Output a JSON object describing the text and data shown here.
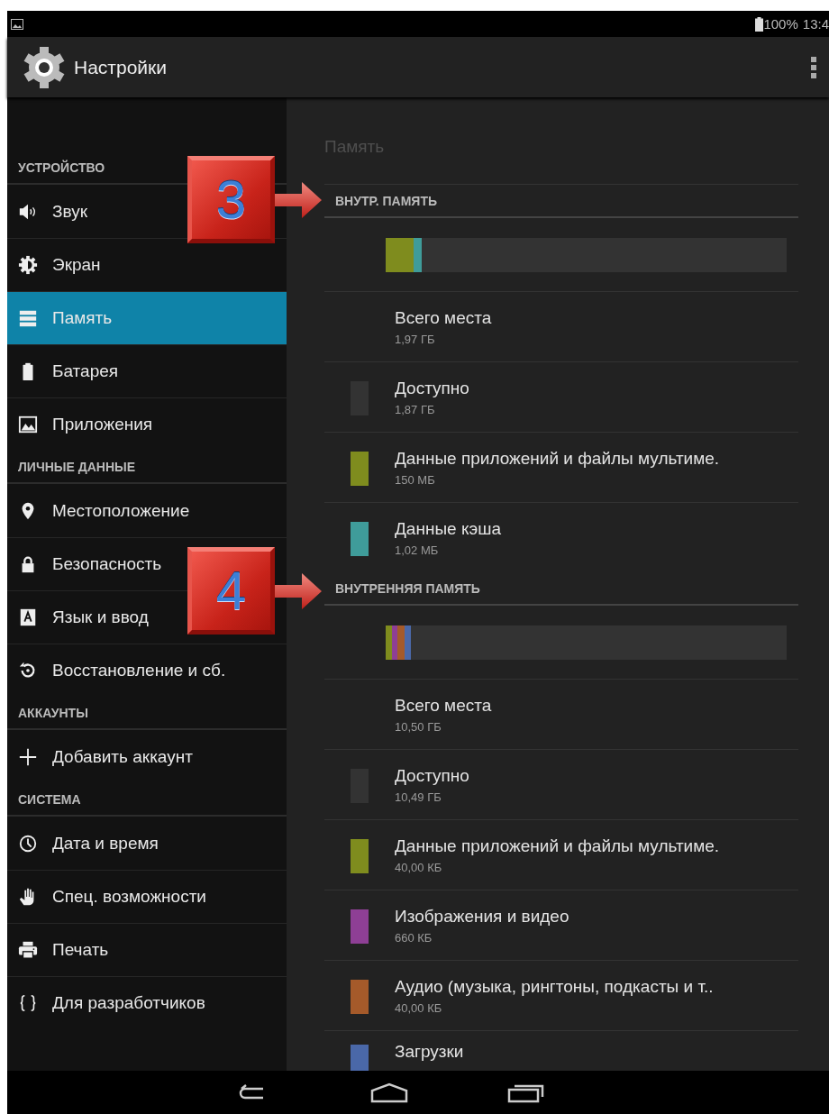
{
  "status_bar": {
    "battery": "100%",
    "time": "13:4"
  },
  "action_bar": {
    "title": "Настройки"
  },
  "sidebar": {
    "sections": [
      {
        "title": "УСТРОЙСТВО",
        "items": [
          {
            "label": "Звук",
            "selected": false
          },
          {
            "label": "Экран",
            "selected": false
          },
          {
            "label": "Память",
            "selected": true
          },
          {
            "label": "Батарея",
            "selected": false
          },
          {
            "label": "Приложения",
            "selected": false
          }
        ]
      },
      {
        "title": "ЛИЧНЫЕ ДАННЫЕ",
        "items": [
          {
            "label": "Местоположение",
            "selected": false
          },
          {
            "label": "Безопасность",
            "selected": false
          },
          {
            "label": "Язык и ввод",
            "selected": false
          },
          {
            "label": "Восстановление и сб.",
            "selected": false
          }
        ]
      },
      {
        "title": "АККАУНТЫ",
        "items": [
          {
            "label": "Добавить аккаунт",
            "selected": false
          }
        ]
      },
      {
        "title": "СИСТЕМА",
        "items": [
          {
            "label": "Дата и время",
            "selected": false
          },
          {
            "label": "Спец. возможности",
            "selected": false
          },
          {
            "label": "Печать",
            "selected": false
          },
          {
            "label": "Для разработчиков",
            "selected": false
          }
        ]
      }
    ]
  },
  "storage": {
    "title": "Память",
    "sections": [
      {
        "title": "ВНУТР. ПАМЯТЬ",
        "bar": {
          "segments": [
            {
              "color": "#7f8c1e",
              "level": 0.07
            },
            {
              "color": "#3f9c9a",
              "level": 0.02
            }
          ]
        },
        "items": [
          {
            "kind": "total",
            "label": "Всего места",
            "value": "1,97 ГБ"
          },
          {
            "kind": "legend",
            "label": "Доступно",
            "value": "1,87 ГБ",
            "color": "#333333"
          },
          {
            "kind": "legend",
            "label": "Данные приложений и файлы мультиме.",
            "value": "150 МБ",
            "color": "#7f8c1e"
          },
          {
            "kind": "legend",
            "label": "Данные кэша",
            "value": "1,02 МБ",
            "color": "#3f9c9a"
          }
        ]
      },
      {
        "title": "ВНУТРЕННЯЯ ПАМЯТЬ",
        "bar": {
          "segments": [
            {
              "color": "#7f8c1e",
              "level": 0.016
            },
            {
              "color": "#8e3f95",
              "level": 0.014
            },
            {
              "color": "#a55a2a",
              "level": 0.018
            },
            {
              "color": "#4a68a8",
              "level": 0.016
            }
          ]
        },
        "items": [
          {
            "kind": "total",
            "label": "Всего места",
            "value": "10,50 ГБ"
          },
          {
            "kind": "legend",
            "label": "Доступно",
            "value": "10,49 ГБ",
            "color": "#333333"
          },
          {
            "kind": "legend",
            "label": "Данные приложений и файлы мультиме.",
            "value": "40,00 КБ",
            "color": "#7f8c1e"
          },
          {
            "kind": "legend",
            "label": "Изображения и видео",
            "value": "660 КБ",
            "color": "#8e3f95"
          },
          {
            "kind": "legend",
            "label": "Аудио (музыка, рингтоны, подкасты и т..",
            "value": "40,00 КБ",
            "color": "#a55a2a"
          },
          {
            "kind": "legend",
            "label": "Загрузки",
            "color": "#4a68a8"
          }
        ]
      }
    ]
  },
  "annotations": [
    {
      "label": "3"
    },
    {
      "label": "4"
    }
  ]
}
